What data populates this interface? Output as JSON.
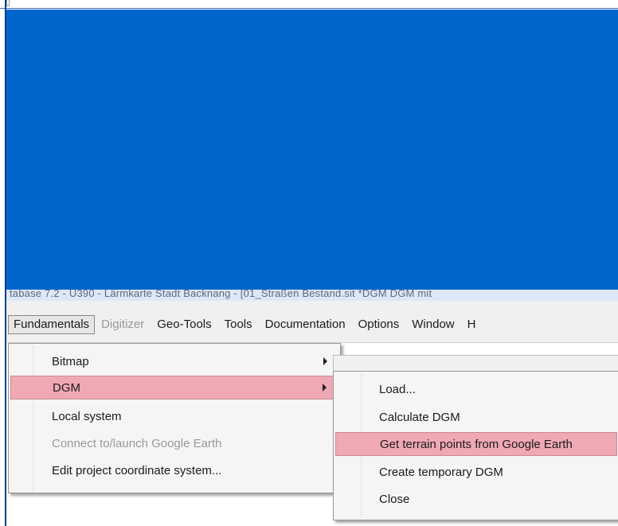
{
  "window": {
    "title": "tabase 7.2 - U390 - Lärmkarte Stadt Backnang - [01_Straßen Bestand.sit *DGM  DGM mit"
  },
  "colors": {
    "blue_panel": "#0066cc",
    "highlight": "#f0a8b4",
    "menu_bg": "#f0f0f0"
  },
  "menubar": {
    "items": [
      {
        "label": "Fundamentals"
      },
      {
        "label": "Digitizer"
      },
      {
        "label": "Geo-Tools"
      },
      {
        "label": "Tools"
      },
      {
        "label": "Documentation"
      },
      {
        "label": "Options"
      },
      {
        "label": "Window"
      },
      {
        "label": "H"
      }
    ]
  },
  "fundamentals_menu": {
    "items": [
      {
        "label": "Bitmap"
      },
      {
        "label": "DGM"
      },
      {
        "label": "Local system"
      },
      {
        "label": "Connect to/launch Google Earth"
      },
      {
        "label": "Edit project coordinate system..."
      }
    ]
  },
  "dgm_submenu": {
    "items": [
      {
        "label": "Load..."
      },
      {
        "label": "Calculate DGM"
      },
      {
        "label": "Get terrain points from Google Earth"
      },
      {
        "label": "Create temporary DGM"
      },
      {
        "label": "Close"
      }
    ]
  }
}
